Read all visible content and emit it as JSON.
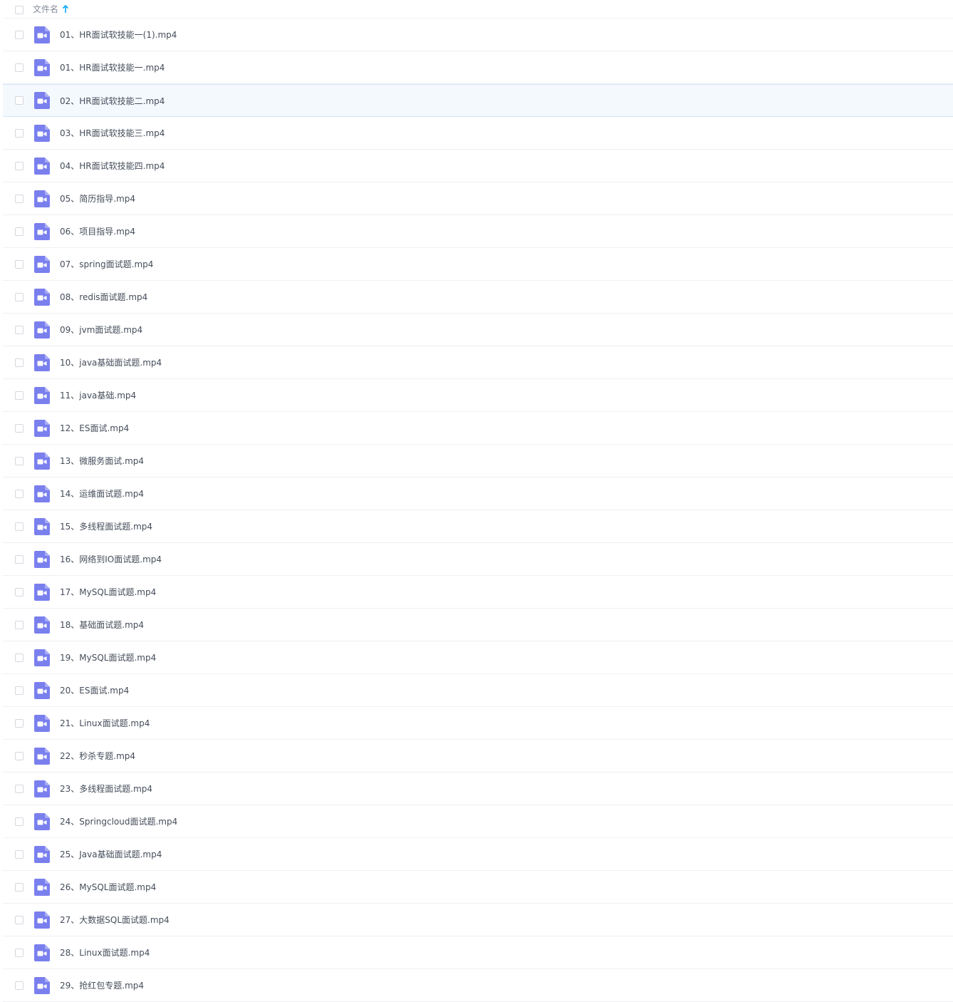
{
  "header": {
    "column_label": "文件名",
    "sort_icon": "arrow-up-icon",
    "sort_color": "#06a7ff"
  },
  "file_icon": "video-file-icon",
  "colors": {
    "icon_bg": "#7a7fee",
    "hover_bg": "#f4f9fe",
    "text": "#454d5a"
  },
  "hovered_index": 2,
  "files": [
    {
      "name": "01、HR面试软技能一(1).mp4"
    },
    {
      "name": "01、HR面试软技能一.mp4"
    },
    {
      "name": "02、HR面试软技能二.mp4"
    },
    {
      "name": "03、HR面试软技能三.mp4"
    },
    {
      "name": "04、HR面试软技能四.mp4"
    },
    {
      "name": "05、简历指导.mp4"
    },
    {
      "name": "06、项目指导.mp4"
    },
    {
      "name": "07、spring面试题.mp4"
    },
    {
      "name": "08、redis面试题.mp4"
    },
    {
      "name": "09、jvm面试题.mp4"
    },
    {
      "name": "10、java基础面试题.mp4"
    },
    {
      "name": "11、java基础.mp4"
    },
    {
      "name": "12、ES面试.mp4"
    },
    {
      "name": "13、微服务面试.mp4"
    },
    {
      "name": "14、运维面试题.mp4"
    },
    {
      "name": "15、多线程面试题.mp4"
    },
    {
      "name": "16、网络到IO面试题.mp4"
    },
    {
      "name": "17、MySQL面试题.mp4"
    },
    {
      "name": "18、基础面试题.mp4"
    },
    {
      "name": "19、MySQL面试题.mp4"
    },
    {
      "name": "20、ES面试.mp4"
    },
    {
      "name": "21、Linux面试题.mp4"
    },
    {
      "name": "22、秒杀专题.mp4"
    },
    {
      "name": "23、多线程面试题.mp4"
    },
    {
      "name": "24、Springcloud面试题.mp4"
    },
    {
      "name": "25、Java基础面试题.mp4"
    },
    {
      "name": "26、MySQL面试题.mp4"
    },
    {
      "name": "27、大数据SQL面试题.mp4"
    },
    {
      "name": "28、Linux面试题.mp4"
    },
    {
      "name": "29、抢红包专题.mp4"
    }
  ]
}
